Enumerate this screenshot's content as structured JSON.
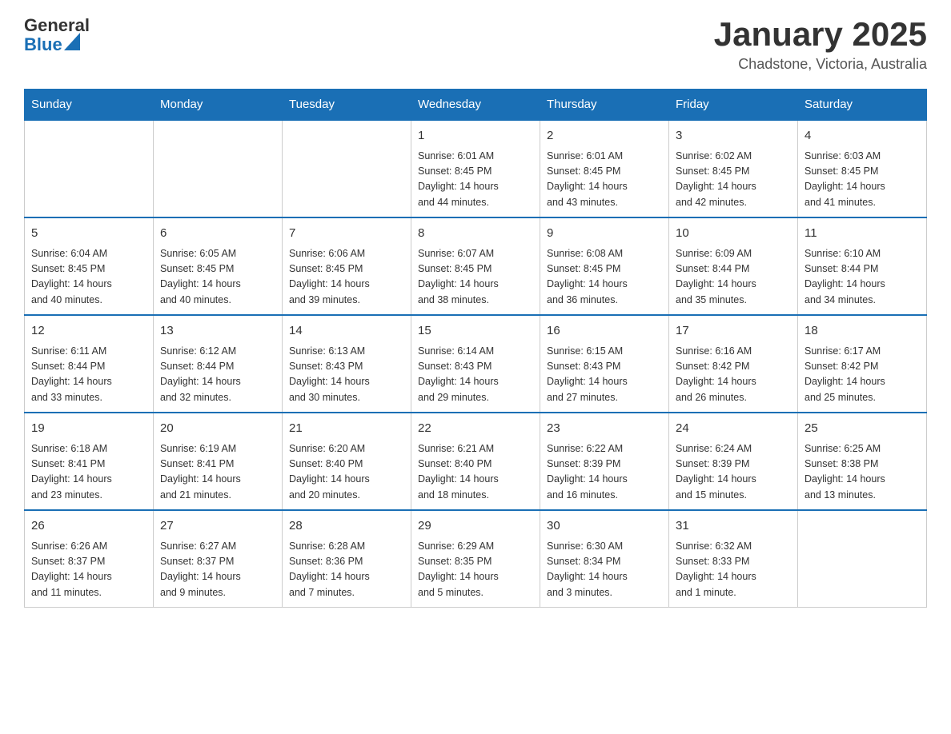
{
  "header": {
    "logo": {
      "general": "General",
      "blue": "Blue"
    },
    "title": "January 2025",
    "subtitle": "Chadstone, Victoria, Australia"
  },
  "calendar": {
    "days_of_week": [
      "Sunday",
      "Monday",
      "Tuesday",
      "Wednesday",
      "Thursday",
      "Friday",
      "Saturday"
    ],
    "weeks": [
      {
        "days": [
          {
            "number": "",
            "info": ""
          },
          {
            "number": "",
            "info": ""
          },
          {
            "number": "",
            "info": ""
          },
          {
            "number": "1",
            "info": "Sunrise: 6:01 AM\nSunset: 8:45 PM\nDaylight: 14 hours\nand 44 minutes."
          },
          {
            "number": "2",
            "info": "Sunrise: 6:01 AM\nSunset: 8:45 PM\nDaylight: 14 hours\nand 43 minutes."
          },
          {
            "number": "3",
            "info": "Sunrise: 6:02 AM\nSunset: 8:45 PM\nDaylight: 14 hours\nand 42 minutes."
          },
          {
            "number": "4",
            "info": "Sunrise: 6:03 AM\nSunset: 8:45 PM\nDaylight: 14 hours\nand 41 minutes."
          }
        ]
      },
      {
        "days": [
          {
            "number": "5",
            "info": "Sunrise: 6:04 AM\nSunset: 8:45 PM\nDaylight: 14 hours\nand 40 minutes."
          },
          {
            "number": "6",
            "info": "Sunrise: 6:05 AM\nSunset: 8:45 PM\nDaylight: 14 hours\nand 40 minutes."
          },
          {
            "number": "7",
            "info": "Sunrise: 6:06 AM\nSunset: 8:45 PM\nDaylight: 14 hours\nand 39 minutes."
          },
          {
            "number": "8",
            "info": "Sunrise: 6:07 AM\nSunset: 8:45 PM\nDaylight: 14 hours\nand 38 minutes."
          },
          {
            "number": "9",
            "info": "Sunrise: 6:08 AM\nSunset: 8:45 PM\nDaylight: 14 hours\nand 36 minutes."
          },
          {
            "number": "10",
            "info": "Sunrise: 6:09 AM\nSunset: 8:44 PM\nDaylight: 14 hours\nand 35 minutes."
          },
          {
            "number": "11",
            "info": "Sunrise: 6:10 AM\nSunset: 8:44 PM\nDaylight: 14 hours\nand 34 minutes."
          }
        ]
      },
      {
        "days": [
          {
            "number": "12",
            "info": "Sunrise: 6:11 AM\nSunset: 8:44 PM\nDaylight: 14 hours\nand 33 minutes."
          },
          {
            "number": "13",
            "info": "Sunrise: 6:12 AM\nSunset: 8:44 PM\nDaylight: 14 hours\nand 32 minutes."
          },
          {
            "number": "14",
            "info": "Sunrise: 6:13 AM\nSunset: 8:43 PM\nDaylight: 14 hours\nand 30 minutes."
          },
          {
            "number": "15",
            "info": "Sunrise: 6:14 AM\nSunset: 8:43 PM\nDaylight: 14 hours\nand 29 minutes."
          },
          {
            "number": "16",
            "info": "Sunrise: 6:15 AM\nSunset: 8:43 PM\nDaylight: 14 hours\nand 27 minutes."
          },
          {
            "number": "17",
            "info": "Sunrise: 6:16 AM\nSunset: 8:42 PM\nDaylight: 14 hours\nand 26 minutes."
          },
          {
            "number": "18",
            "info": "Sunrise: 6:17 AM\nSunset: 8:42 PM\nDaylight: 14 hours\nand 25 minutes."
          }
        ]
      },
      {
        "days": [
          {
            "number": "19",
            "info": "Sunrise: 6:18 AM\nSunset: 8:41 PM\nDaylight: 14 hours\nand 23 minutes."
          },
          {
            "number": "20",
            "info": "Sunrise: 6:19 AM\nSunset: 8:41 PM\nDaylight: 14 hours\nand 21 minutes."
          },
          {
            "number": "21",
            "info": "Sunrise: 6:20 AM\nSunset: 8:40 PM\nDaylight: 14 hours\nand 20 minutes."
          },
          {
            "number": "22",
            "info": "Sunrise: 6:21 AM\nSunset: 8:40 PM\nDaylight: 14 hours\nand 18 minutes."
          },
          {
            "number": "23",
            "info": "Sunrise: 6:22 AM\nSunset: 8:39 PM\nDaylight: 14 hours\nand 16 minutes."
          },
          {
            "number": "24",
            "info": "Sunrise: 6:24 AM\nSunset: 8:39 PM\nDaylight: 14 hours\nand 15 minutes."
          },
          {
            "number": "25",
            "info": "Sunrise: 6:25 AM\nSunset: 8:38 PM\nDaylight: 14 hours\nand 13 minutes."
          }
        ]
      },
      {
        "days": [
          {
            "number": "26",
            "info": "Sunrise: 6:26 AM\nSunset: 8:37 PM\nDaylight: 14 hours\nand 11 minutes."
          },
          {
            "number": "27",
            "info": "Sunrise: 6:27 AM\nSunset: 8:37 PM\nDaylight: 14 hours\nand 9 minutes."
          },
          {
            "number": "28",
            "info": "Sunrise: 6:28 AM\nSunset: 8:36 PM\nDaylight: 14 hours\nand 7 minutes."
          },
          {
            "number": "29",
            "info": "Sunrise: 6:29 AM\nSunset: 8:35 PM\nDaylight: 14 hours\nand 5 minutes."
          },
          {
            "number": "30",
            "info": "Sunrise: 6:30 AM\nSunset: 8:34 PM\nDaylight: 14 hours\nand 3 minutes."
          },
          {
            "number": "31",
            "info": "Sunrise: 6:32 AM\nSunset: 8:33 PM\nDaylight: 14 hours\nand 1 minute."
          },
          {
            "number": "",
            "info": ""
          }
        ]
      }
    ]
  }
}
